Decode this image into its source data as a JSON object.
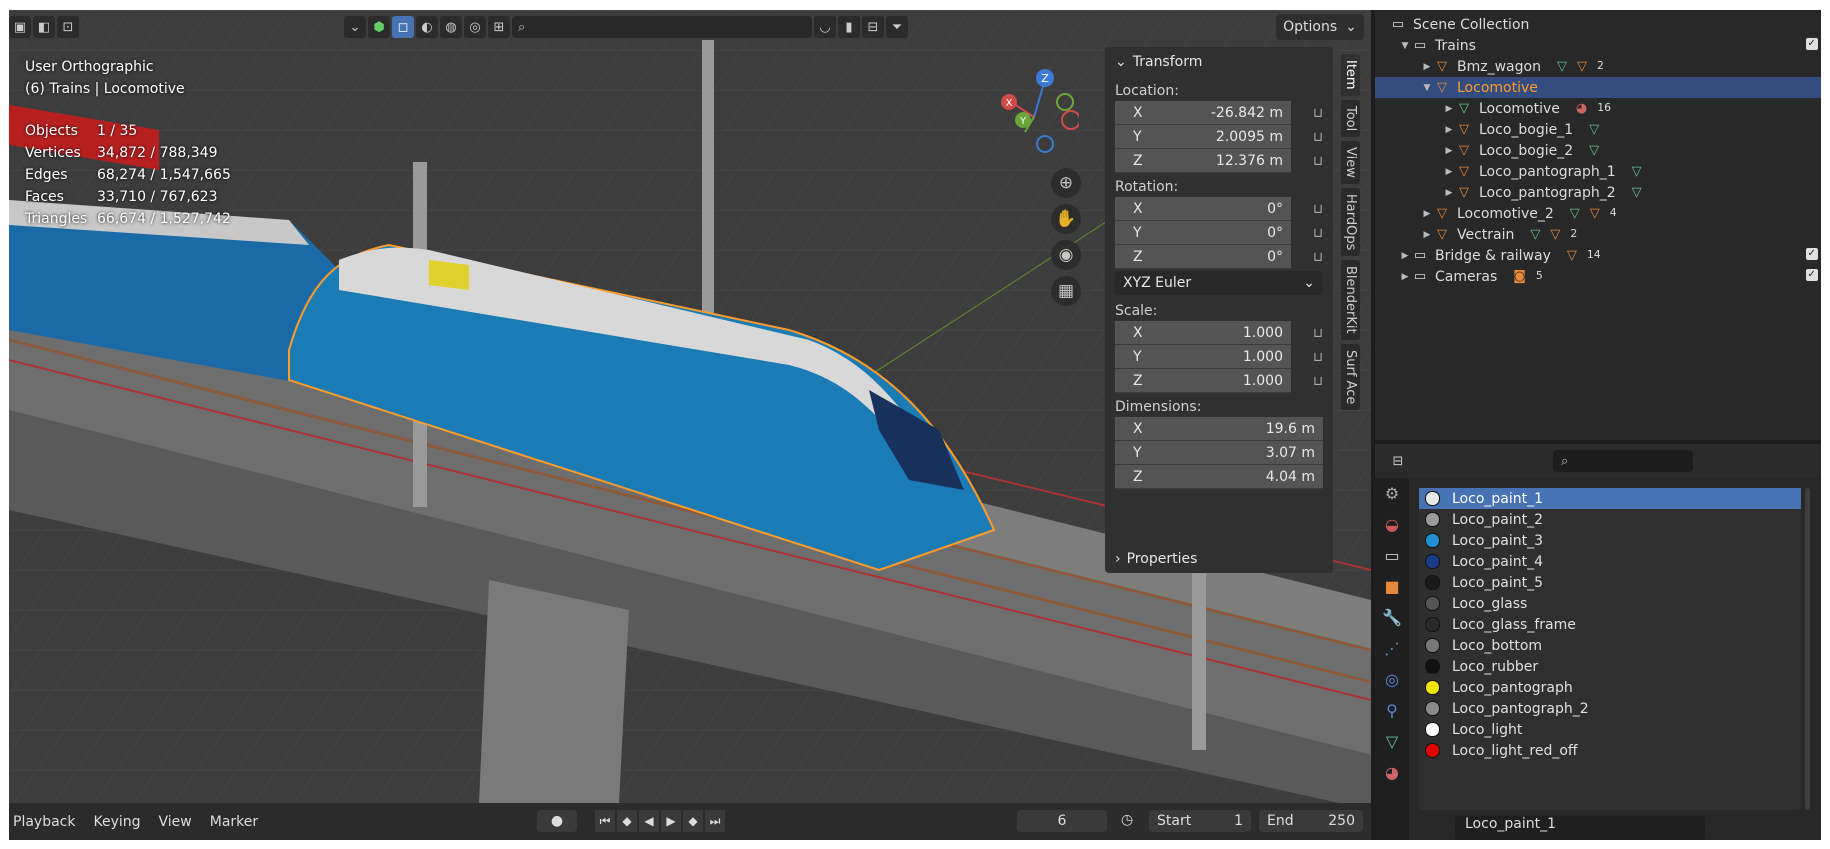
{
  "viewport": {
    "view_name": "User Orthographic",
    "context": "(6) Trains | Locomotive",
    "stats": [
      {
        "label": "Objects",
        "value": "1 / 35"
      },
      {
        "label": "Vertices",
        "value": "34,872 / 788,349"
      },
      {
        "label": "Edges",
        "value": "68,274 / 1,547,665"
      },
      {
        "label": "Faces",
        "value": "33,710 / 767,623"
      },
      {
        "label": "Triangles",
        "value": "66,674 / 1,527,742"
      }
    ],
    "options_label": "Options",
    "gizmo": {
      "z": "Z",
      "x": "X",
      "y": "Y"
    }
  },
  "npanel": {
    "transform_title": "Transform",
    "location_label": "Location:",
    "location": [
      {
        "axis": "X",
        "value": "-26.842 m"
      },
      {
        "axis": "Y",
        "value": "2.0095 m"
      },
      {
        "axis": "Z",
        "value": "12.376 m"
      }
    ],
    "rotation_label": "Rotation:",
    "rotation": [
      {
        "axis": "X",
        "value": "0°"
      },
      {
        "axis": "Y",
        "value": "0°"
      },
      {
        "axis": "Z",
        "value": "0°"
      }
    ],
    "rotation_mode": "XYZ Euler",
    "scale_label": "Scale:",
    "scale": [
      {
        "axis": "X",
        "value": "1.000"
      },
      {
        "axis": "Y",
        "value": "1.000"
      },
      {
        "axis": "Z",
        "value": "1.000"
      }
    ],
    "dimensions_label": "Dimensions:",
    "dimensions": [
      {
        "axis": "X",
        "value": "19.6 m"
      },
      {
        "axis": "Y",
        "value": "3.07 m"
      },
      {
        "axis": "Z",
        "value": "4.04 m"
      }
    ],
    "properties_title": "Properties",
    "tabs": [
      "Item",
      "Tool",
      "View",
      "HardOps",
      "BlenderKit",
      "Surf Ace"
    ]
  },
  "timeline": {
    "menus": [
      "Playback",
      "Keying",
      "View",
      "Marker"
    ],
    "current_frame": "6",
    "start_label": "Start",
    "start_value": "1",
    "end_label": "End",
    "end_value": "250"
  },
  "outliner": {
    "rows": [
      {
        "name": "Scene Collection"
      },
      {
        "name": "Trains"
      },
      {
        "name": "Bmz_wagon",
        "badge": "2"
      },
      {
        "name": "Locomotive"
      },
      {
        "name": "Locomotive",
        "badge": "16"
      },
      {
        "name": "Loco_bogie_1"
      },
      {
        "name": "Loco_bogie_2"
      },
      {
        "name": "Loco_pantograph_1"
      },
      {
        "name": "Loco_pantograph_2"
      },
      {
        "name": "Locomotive_2",
        "badge": "4"
      },
      {
        "name": "Vectrain",
        "badge": "2"
      },
      {
        "name": "Bridge & railway",
        "badge": "14"
      },
      {
        "name": "Cameras",
        "badge": "5"
      }
    ]
  },
  "materials": [
    {
      "name": "Loco_paint_1",
      "color": "#e8e8e8"
    },
    {
      "name": "Loco_paint_2",
      "color": "#9a9a9a"
    },
    {
      "name": "Loco_paint_3",
      "color": "#1f8fd0"
    },
    {
      "name": "Loco_paint_4",
      "color": "#1b3a8a"
    },
    {
      "name": "Loco_paint_5",
      "color": "#1a1a1a"
    },
    {
      "name": "Loco_glass",
      "color": "#555555"
    },
    {
      "name": "Loco_glass_frame",
      "color": "#2a2a2a"
    },
    {
      "name": "Loco_bottom",
      "color": "#777777"
    },
    {
      "name": "Loco_rubber",
      "color": "#111111"
    },
    {
      "name": "Loco_pantograph",
      "color": "#f2e400"
    },
    {
      "name": "Loco_pantograph_2",
      "color": "#8a8a8a"
    },
    {
      "name": "Loco_light",
      "color": "#ffffff"
    },
    {
      "name": "Loco_light_red_off",
      "color": "#e00000"
    }
  ],
  "active_material": "Loco_paint_1",
  "colors": {
    "selection": "#4772b3",
    "active_object": "#ff9c2a",
    "locomotive_blue": "#1b7bb5"
  }
}
